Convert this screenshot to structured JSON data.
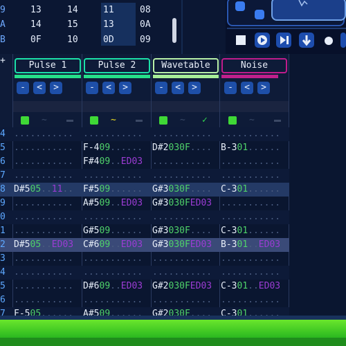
{
  "order_list": {
    "rows": [
      {
        "label": "9",
        "cells": [
          "13",
          "14",
          "11",
          "08"
        ]
      },
      {
        "label": "A",
        "cells": [
          "14",
          "15",
          "13",
          "0A"
        ]
      },
      {
        "label": "B",
        "cells": [
          "0F",
          "10",
          "0D",
          "09"
        ]
      }
    ]
  },
  "transport": {
    "buttons": [
      "stop",
      "play",
      "play-pattern",
      "step-down",
      "record",
      "loop"
    ]
  },
  "row_num_header": "+",
  "channels": [
    {
      "name": "Pulse 1",
      "color": "#1ce0a8",
      "bar_color": "#26e08a",
      "wave": "~",
      "wave_color": "#3a4a68",
      "extra": "-",
      "extra_color": "#3c4a66"
    },
    {
      "name": "Pulse 2",
      "color": "#1ce0a8",
      "bar_color": "#26e08a",
      "wave": "~",
      "wave_color": "#f0e020",
      "extra": "-",
      "extra_color": "#3c4a66"
    },
    {
      "name": "Wavetable",
      "color": "#b8f0a8",
      "bar_color": "#a8ee98",
      "wave": "~",
      "wave_color": "#3a4a68",
      "extra": "✓",
      "extra_color": "#30d850"
    },
    {
      "name": "Noise",
      "color": "#c01c8c",
      "bar_color": "#c0208c",
      "wave": "~",
      "wave_color": "#3a4a68",
      "extra": "-",
      "extra_color": "#3c4a66"
    }
  ],
  "channel_buttons": [
    "-",
    "<",
    ">"
  ],
  "pattern_rows": [
    {
      "num": "4",
      "cells": [
        "",
        "",
        "",
        ""
      ]
    },
    {
      "num": "5",
      "cells": [
        "",
        "F-409",
        "D#2030F",
        "B-301"
      ]
    },
    {
      "num": "6",
      "cells": [
        "",
        "F#409..ED03",
        "",
        ""
      ]
    },
    {
      "num": "7",
      "cells": [
        "",
        "",
        "",
        ""
      ]
    },
    {
      "num": "8",
      "cells": [
        "D#505..11..",
        "F#509",
        "G#3030F",
        "C-301"
      ]
    },
    {
      "num": "9",
      "cells": [
        "",
        "A#509..ED03",
        "G#3030FED03",
        ""
      ]
    },
    {
      "num": "0",
      "cells": [
        "",
        "",
        "",
        ""
      ]
    },
    {
      "num": "1",
      "cells": [
        "",
        "G#509",
        "G#3030F",
        "C-301"
      ]
    },
    {
      "num": "2",
      "cells": [
        "D#505..ED03",
        "C#609..ED03",
        "G#3030FED03",
        "B-301..ED03"
      ]
    },
    {
      "num": "3",
      "cells": [
        "",
        "",
        "",
        ""
      ]
    },
    {
      "num": "4",
      "cells": [
        "",
        "",
        "",
        ""
      ]
    },
    {
      "num": "5",
      "cells": [
        "",
        "D#609..ED03",
        "G#2030FED03",
        "C-301..ED03"
      ]
    },
    {
      "num": "6",
      "cells": [
        "",
        "",
        "",
        ""
      ]
    },
    {
      "num": "7",
      "cells": [
        "F-505",
        "A#509",
        "G#2030F",
        "C-301"
      ]
    }
  ],
  "colors": {
    "note": "#e6edf8",
    "instrument": "#4fd26a",
    "effect": "#9b3cd4",
    "empty": "#4a5c80",
    "row_number": "#5da8ff"
  }
}
